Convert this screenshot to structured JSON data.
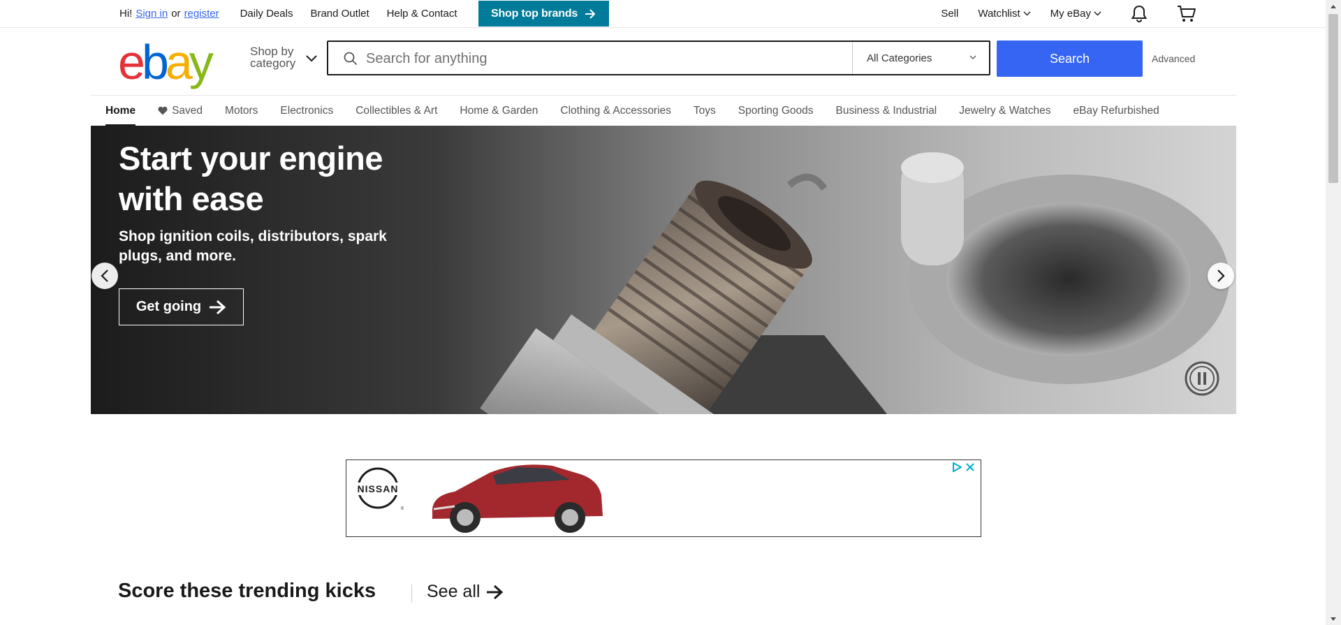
{
  "topbar": {
    "greeting": "Hi!",
    "sign_in": "Sign in",
    "or": "or",
    "register": "register",
    "links": [
      "Daily Deals",
      "Brand Outlet",
      "Help & Contact"
    ],
    "promo_button": "Shop top brands",
    "right": {
      "sell": "Sell",
      "watchlist": "Watchlist",
      "my_ebay": "My eBay"
    }
  },
  "header": {
    "shop_by": "Shop by",
    "category": "category",
    "search_placeholder": "Search for anything",
    "category_select": "All Categories",
    "search_button": "Search",
    "advanced": "Advanced"
  },
  "nav": {
    "items": [
      "Home",
      "Saved",
      "Motors",
      "Electronics",
      "Collectibles & Art",
      "Home & Garden",
      "Clothing & Accessories",
      "Toys",
      "Sporting Goods",
      "Business & Industrial",
      "Jewelry & Watches",
      "eBay Refurbished"
    ]
  },
  "hero": {
    "title": "Start your engine with ease",
    "subtitle": "Shop ignition coils, distributors, spark plugs, and more.",
    "cta": "Get going"
  },
  "ad": {
    "brand": "NISSAN"
  },
  "section": {
    "title": "Score these trending kicks",
    "see_all": "See all"
  },
  "colors": {
    "accent": "#3665f3",
    "promo": "#007b99",
    "logo_e": "#e53238",
    "logo_b": "#0064d2",
    "logo_a": "#f5af02",
    "logo_y": "#86b817"
  }
}
